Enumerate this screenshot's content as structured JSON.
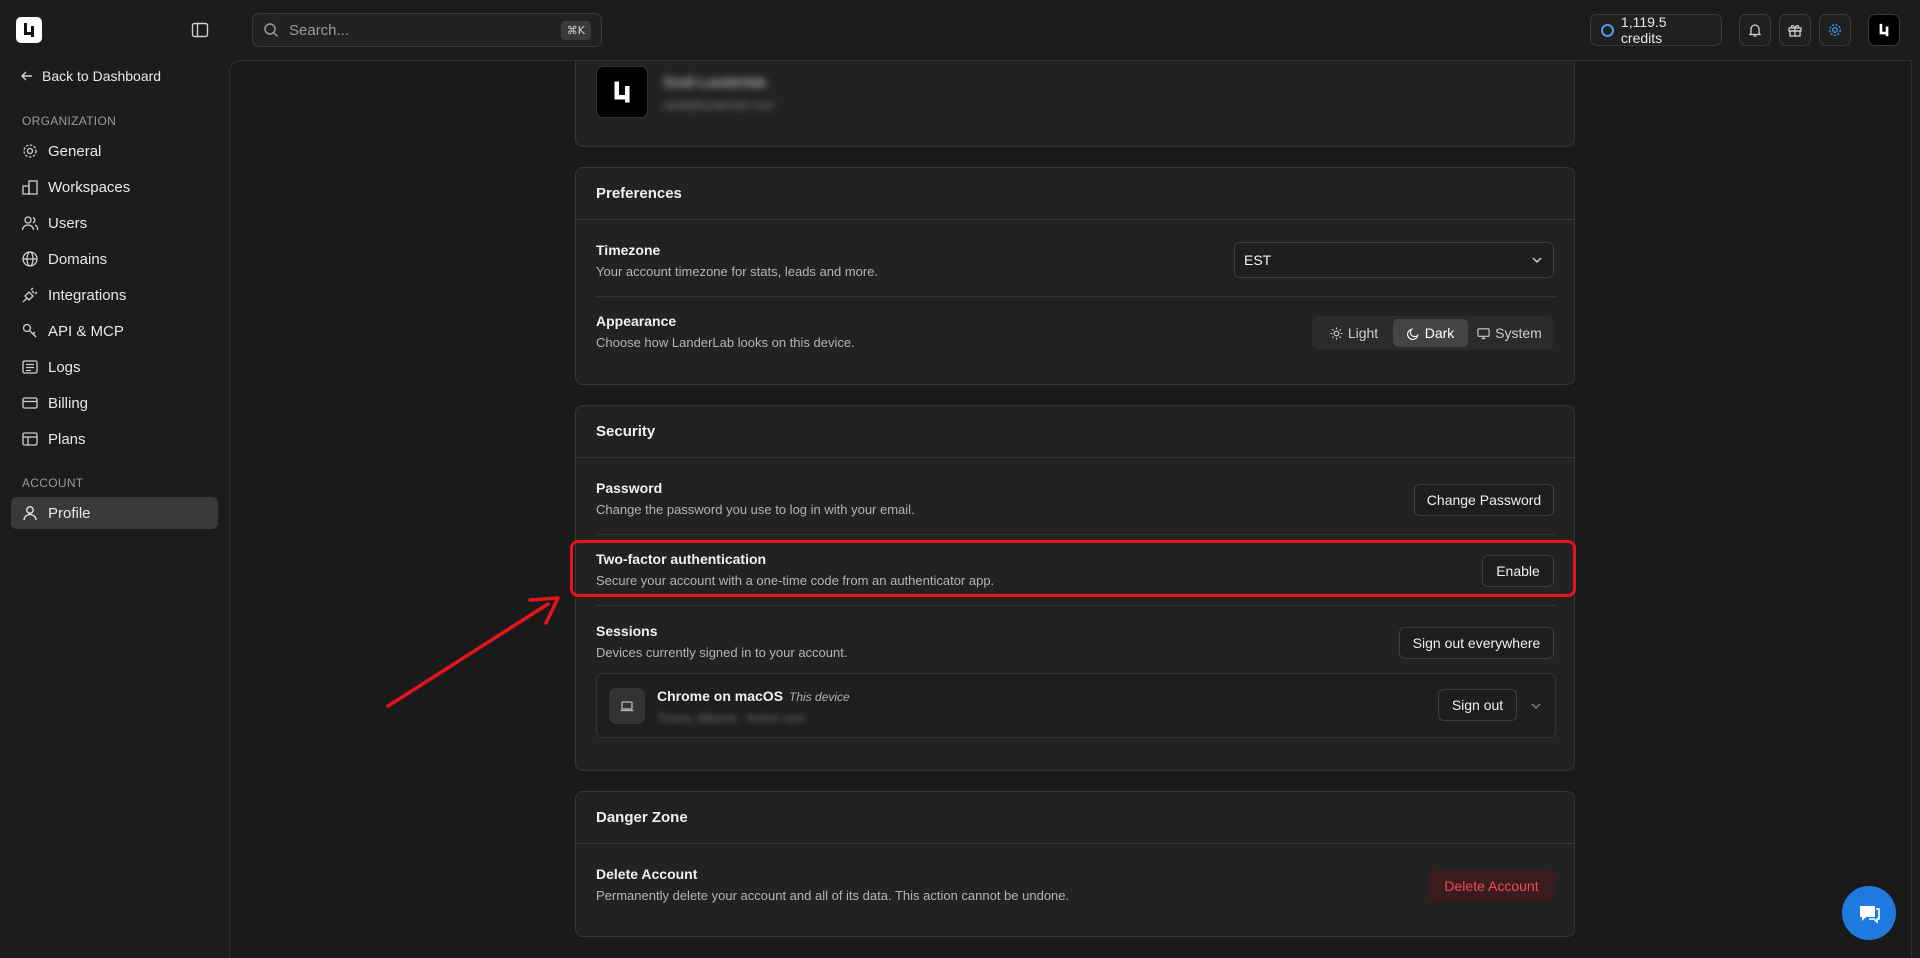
{
  "topbar": {
    "search_placeholder": "Search...",
    "search_shortcut": "⌘K",
    "credits": "1,119.5 credits"
  },
  "sidebar": {
    "back_label": "Back to Dashboard",
    "org_section": "ORGANIZATION",
    "account_section": "ACCOUNT",
    "items": [
      {
        "label": "General",
        "icon": "gear-icon"
      },
      {
        "label": "Workspaces",
        "icon": "workspaces-icon"
      },
      {
        "label": "Users",
        "icon": "users-icon"
      },
      {
        "label": "Domains",
        "icon": "globe-icon"
      },
      {
        "label": "Integrations",
        "icon": "plug-icon"
      },
      {
        "label": "API & MCP",
        "icon": "key-icon"
      },
      {
        "label": "Logs",
        "icon": "logs-icon"
      },
      {
        "label": "Billing",
        "icon": "card-icon"
      },
      {
        "label": "Plans",
        "icon": "plans-icon"
      }
    ],
    "profile_label": "Profile"
  },
  "profile_card": {
    "name": "Dodi Landerlab",
    "email": "dodi@landerlab.com"
  },
  "preferences": {
    "title": "Preferences",
    "timezone_title": "Timezone",
    "timezone_desc": "Your account timezone for stats, leads and more.",
    "timezone_value": "EST",
    "appearance_title": "Appearance",
    "appearance_desc": "Choose how LanderLab looks on this device.",
    "appearance_options": [
      "Light",
      "Dark",
      "System"
    ],
    "appearance_selected": "Dark"
  },
  "security": {
    "title": "Security",
    "password_title": "Password",
    "password_desc": "Change the password you use to log in with your email.",
    "password_button": "Change Password",
    "twofa_title": "Two-factor authentication",
    "twofa_desc": "Secure your account with a one-time code from an authenticator app.",
    "twofa_button": "Enable",
    "sessions_title": "Sessions",
    "sessions_desc": "Devices currently signed in to your account.",
    "sessions_button": "Sign out everywhere",
    "session_name": "Chrome on macOS",
    "session_tag": "This device",
    "session_meta": "Tirana, Albania · Active now",
    "session_button": "Sign out"
  },
  "danger": {
    "title": "Danger Zone",
    "delete_title": "Delete Account",
    "delete_desc": "Permanently delete your account and all of its data. This action cannot be undone.",
    "delete_button": "Delete Account"
  },
  "colors": {
    "accent": "#1f7ae0",
    "highlight": "#e4141b",
    "danger": "#ef4a55"
  }
}
